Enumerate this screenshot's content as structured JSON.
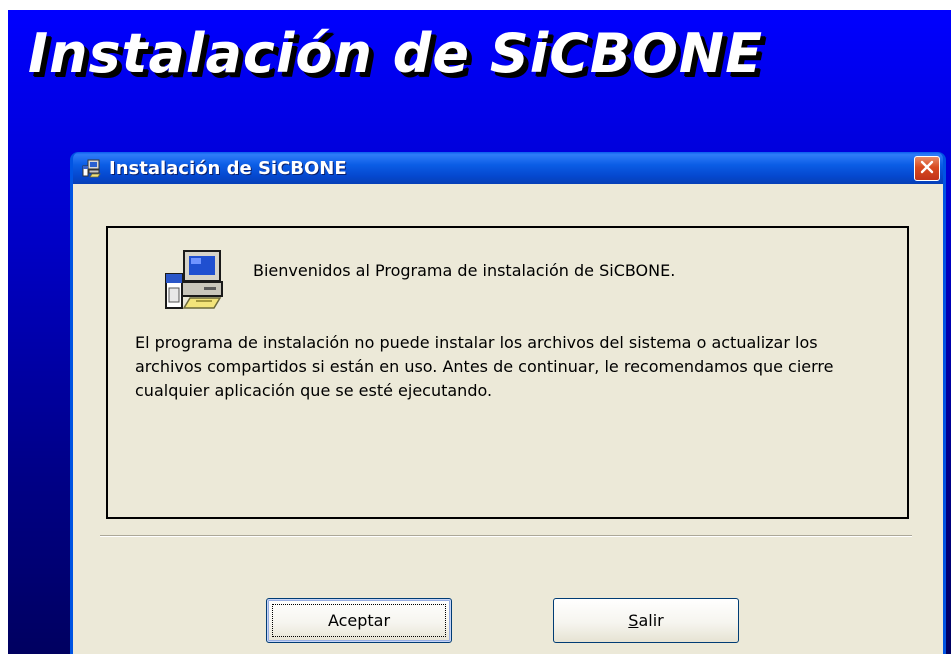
{
  "banner": {
    "title": "Instalación de SiCBONE"
  },
  "dialog": {
    "title": "Instalación de SiCBONE",
    "title_icon": "setup-computer-icon",
    "close_icon": "close-icon",
    "app_icon": "setup-computer-icon",
    "welcome_text": "Bienvenidos al Programa de instalación de SiCBONE.",
    "notice_text": "El programa de instalación no puede instalar los archivos del sistema o actualizar los archivos compartidos si están en uso. Antes de continuar, le recomendamos que cierre cualquier aplicación que se esté ejecutando.",
    "buttons": {
      "ok_label": "Aceptar",
      "exit_mnemonic": "S",
      "exit_rest": "alir"
    }
  },
  "colors": {
    "backdrop_top": "#0000ff",
    "backdrop_bottom": "#000060",
    "titlebar": "#0054e3",
    "dialog_face": "#ece9d8",
    "close_button": "#d84a20"
  }
}
